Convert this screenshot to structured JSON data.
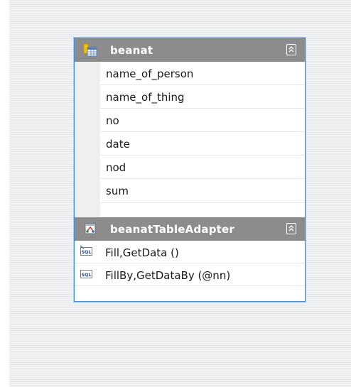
{
  "table": {
    "name": "beanat",
    "columns": [
      {
        "name": "name_of_person"
      },
      {
        "name": "name_of_thing"
      },
      {
        "name": "no"
      },
      {
        "name": "date"
      },
      {
        "name": "nod"
      },
      {
        "name": "sum"
      }
    ],
    "icon": "table-icon",
    "collapse_icon": "collapse-chevrons-icon"
  },
  "adapter": {
    "name": "beanatTableAdapter",
    "icon": "table-adapter-icon",
    "collapse_icon": "collapse-chevrons-icon",
    "queries": [
      {
        "label": "Fill,GetData ()",
        "icon": "sql-query-icon"
      },
      {
        "label": "FillBy,GetDataBy (@nn)",
        "icon": "sql-query-icon"
      }
    ]
  },
  "colors": {
    "header_bg": "#8c8c8c",
    "selection_border": "#3d8fe3",
    "canvas_bg": "#eeeff0"
  }
}
